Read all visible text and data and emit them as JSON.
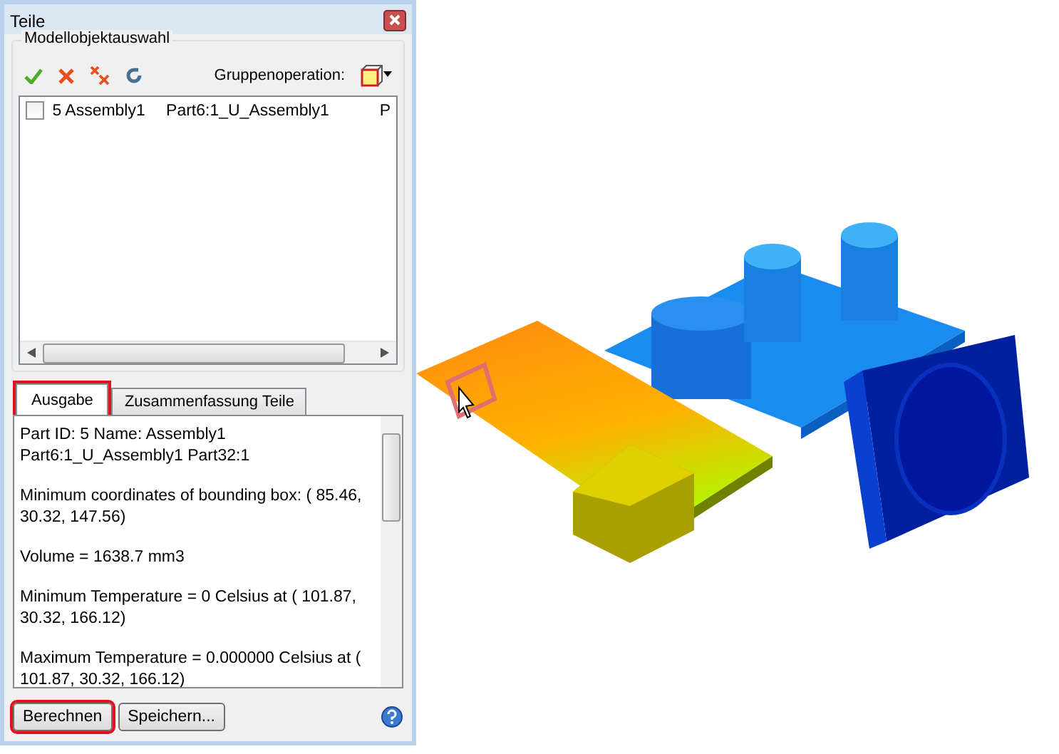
{
  "panel": {
    "title": "Teile",
    "group_title": "Modellobjektauswahl",
    "group_operation_label": "Gruppenoperation:"
  },
  "parts_list": {
    "rows": [
      {
        "checked": false,
        "cells": [
          "5 Assembly1",
          "Part6:1_U_Assembly1",
          "P"
        ]
      }
    ]
  },
  "tabs": [
    {
      "label": "Ausgabe",
      "selected": true,
      "highlighted": true
    },
    {
      "label": "Zusammenfassung Teile",
      "selected": false,
      "highlighted": false
    }
  ],
  "output_lines": [
    "Part ID: 5 Name: Assembly1 Part6:1_U_Assembly1 Part32:1",
    "Minimum coordinates of bounding box: ( 85.46, 30.32, 147.56)",
    "Volume = 1638.7 mm3",
    "Minimum Temperature = 0 Celsius at ( 101.87, 30.32, 166.12)",
    "Maximum Temperature = 0.000000 Celsius at ( 101.87, 30.32, 166.12)"
  ],
  "buttons": [
    {
      "label": "Berechnen",
      "highlighted": true
    },
    {
      "label": "Speichern...",
      "highlighted": false
    }
  ]
}
